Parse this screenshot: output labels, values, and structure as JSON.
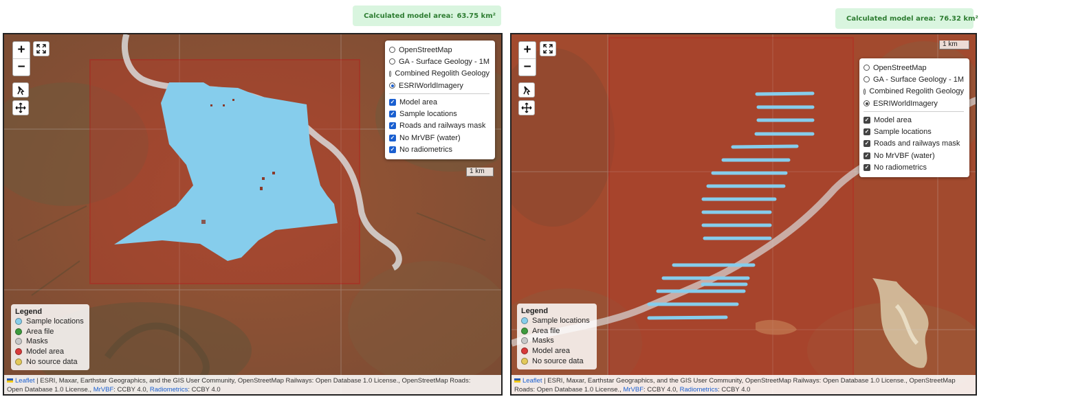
{
  "left": {
    "area_badge": {
      "label": "Calculated model area:",
      "value": "63.75 km²"
    },
    "layers": {
      "base": [
        "OpenStreetMap",
        "GA - Surface Geology - 1M",
        "Combined Regolith Geology",
        "ESRIWorldImagery"
      ],
      "overlays": [
        "Model area",
        "Sample locations",
        "Roads and railways mask",
        "No MrVBF (water)",
        "No radiometrics"
      ],
      "selected_base": "ESRIWorldImagery"
    },
    "scale": "1 km",
    "legend": {
      "title": "Legend",
      "items": [
        "Sample locations",
        "Area file",
        "Masks",
        "Model area",
        "No source data"
      ]
    },
    "attribution": {
      "leaflet": "Leaflet",
      "text1": " | ESRI, Maxar, Earthstar Geographics, and the GIS User Community, OpenStreetMap Railways: Open Database 1.0 License., OpenStreetMap Roads:",
      "text2": "Open Database 1.0 License., ",
      "mrvbf": "MrVBF",
      "text3": ": CCBY 4.0, ",
      "radiometrics": "Radiometrics",
      "text4": ": CCBY 4.0"
    }
  },
  "right": {
    "area_badge": {
      "label": "Calculated model area:",
      "value": "76.32 km²"
    },
    "layers": {
      "base": [
        "OpenStreetMap",
        "GA - Surface Geology - 1M",
        "Combined Regolith Geology",
        "ESRIWorldImagery"
      ],
      "overlays": [
        "Model area",
        "Sample locations",
        "Roads and railways mask",
        "No MrVBF (water)",
        "No radiometrics"
      ],
      "selected_base": "ESRIWorldImagery"
    },
    "scale": "1 km",
    "legend": {
      "title": "Legend",
      "items": [
        "Sample locations",
        "Area file",
        "Masks",
        "Model area",
        "No source data"
      ]
    },
    "attribution": {
      "leaflet": "Leaflet",
      "text1": " | ESRI, Maxar, Earthstar Geographics, and the GIS User Community, OpenStreetMap Railways: Open Database 1.0 License., OpenStreetMap",
      "text2": "Roads: Open Database 1.0 License., ",
      "mrvbf": "MrVBF",
      "text3": ": CCBY 4.0, ",
      "radiometrics": "Radiometrics",
      "text4": ": CCBY 4.0"
    }
  },
  "legend_colors": {
    "sample_locations": "#87ceeb",
    "area_file": "#3e9b3e",
    "masks": "#c8c8c8",
    "model_area": "#d93a3a",
    "no_source_data": "#e3c95a"
  },
  "controls": {
    "zoom_in": "+",
    "zoom_out": "−"
  },
  "icons": [
    "map-icon",
    "fullscreen-icon",
    "draw-polygon-icon",
    "pan-move-icon",
    "flag-icon"
  ]
}
